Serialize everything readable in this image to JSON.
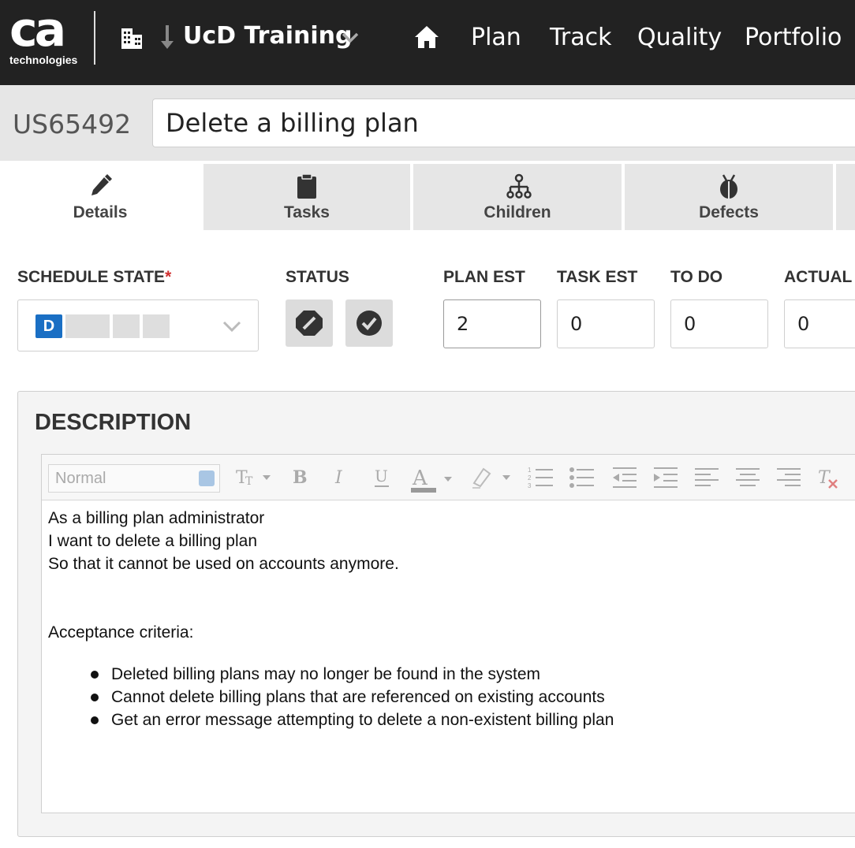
{
  "brand": {
    "logo_mark": "ca",
    "logo_sub": "technologies"
  },
  "nav": {
    "workspace": "UcD Training",
    "items": [
      "Plan",
      "Track",
      "Quality",
      "Portfolio"
    ],
    "icons": {
      "workspace": "building-icon",
      "direction": "arrow-down-icon",
      "dropdown": "chevron-down-icon",
      "home": "home-icon"
    }
  },
  "artifact": {
    "id": "US65492",
    "title": "Delete a billing plan"
  },
  "tabs": [
    {
      "label": "Details",
      "icon": "pencil-icon",
      "active": true
    },
    {
      "label": "Tasks",
      "icon": "clipboard-icon",
      "active": false
    },
    {
      "label": "Children",
      "icon": "hierarchy-icon",
      "active": false
    },
    {
      "label": "Defects",
      "icon": "bug-icon",
      "active": false
    }
  ],
  "fields": {
    "schedule_state": {
      "label": "SCHEDULE STATE",
      "required_mark": "*",
      "value": "D"
    },
    "status": {
      "label": "STATUS",
      "icons": [
        "blocked-icon",
        "ready-check-icon"
      ]
    },
    "plan_est": {
      "label": "PLAN EST",
      "value": "2"
    },
    "task_est": {
      "label": "TASK EST",
      "value": "0"
    },
    "to_do": {
      "label": "TO DO",
      "value": "0"
    },
    "actual": {
      "label": "ACTUAL",
      "value": "0"
    }
  },
  "description": {
    "heading": "DESCRIPTION",
    "format_select": "Normal",
    "lines": [
      "As a billing plan administrator",
      "I want to delete a billing plan",
      "So that it cannot be used on accounts anymore.",
      "",
      "",
      "Acceptance criteria:"
    ],
    "bullets": [
      "Deleted billing plans may no longer be found in the system",
      "Cannot delete billing plans that are referenced on existing accounts",
      "Get an error message attempting to delete a non-existent billing plan"
    ]
  },
  "colors": {
    "nav_bg": "#222222",
    "state_badge": "#1a6fc4",
    "required": "#d03030"
  }
}
